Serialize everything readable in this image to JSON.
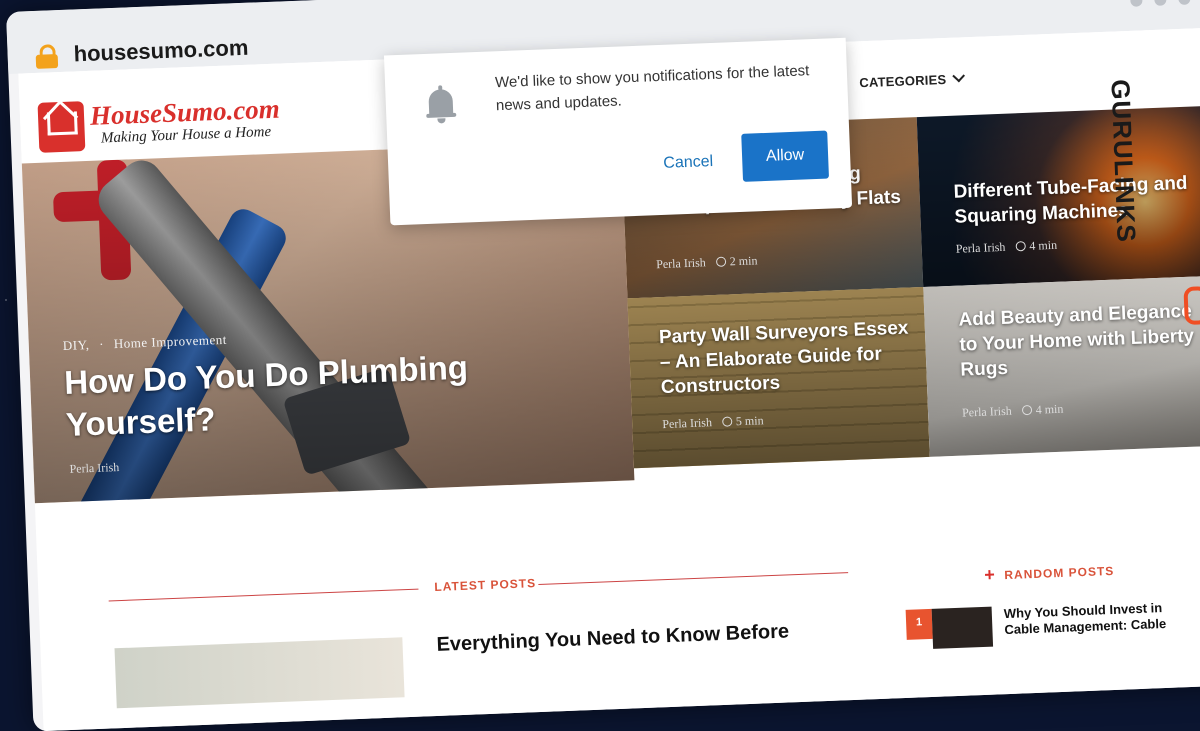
{
  "browser": {
    "url": "housesumo.com"
  },
  "site": {
    "logo_title": "HouseSumo.com",
    "logo_tagline": "Making Your House a Home",
    "nav_categories": "CATEGORIES"
  },
  "notification": {
    "message": "We'd like to show you notifications for the latest news and updates.",
    "cancel_label": "Cancel",
    "allow_label": "Allow"
  },
  "hero": {
    "main": {
      "cat1": "DIY,",
      "cat2": "Home Improvement",
      "title": "How Do You Do Plumbing Yourself?",
      "author": "Perla Irish"
    },
    "tiles": [
      {
        "title": "... Know Before Buying Transportable Granny Flats",
        "author": "Perla Irish",
        "read": "2 min"
      },
      {
        "title": "Different Tube-Facing and Squaring Machines",
        "author": "Perla Irish",
        "read": "4 min"
      },
      {
        "title": "Party Wall Surveyors Essex – An Elaborate Guide for Constructors",
        "author": "Perla Irish",
        "read": "5 min"
      },
      {
        "title": "Add Beauty and Elegance to Your Home with Liberty Rugs",
        "author": "Perla Irish",
        "read": "4 min"
      }
    ]
  },
  "sections": {
    "latest_label": "LATEST POSTS",
    "random_label": "RANDOM POSTS"
  },
  "latest_post": {
    "title": "Everything You Need to Know Before"
  },
  "random_post": {
    "number": "1",
    "title": "Why You Should Invest in Cable Management: Cable"
  },
  "brand_overlay": {
    "text": "GURULINKS"
  },
  "colors": {
    "accent": "#d9302c",
    "allow_button": "#1a73c8",
    "section_label": "#d9533a"
  }
}
